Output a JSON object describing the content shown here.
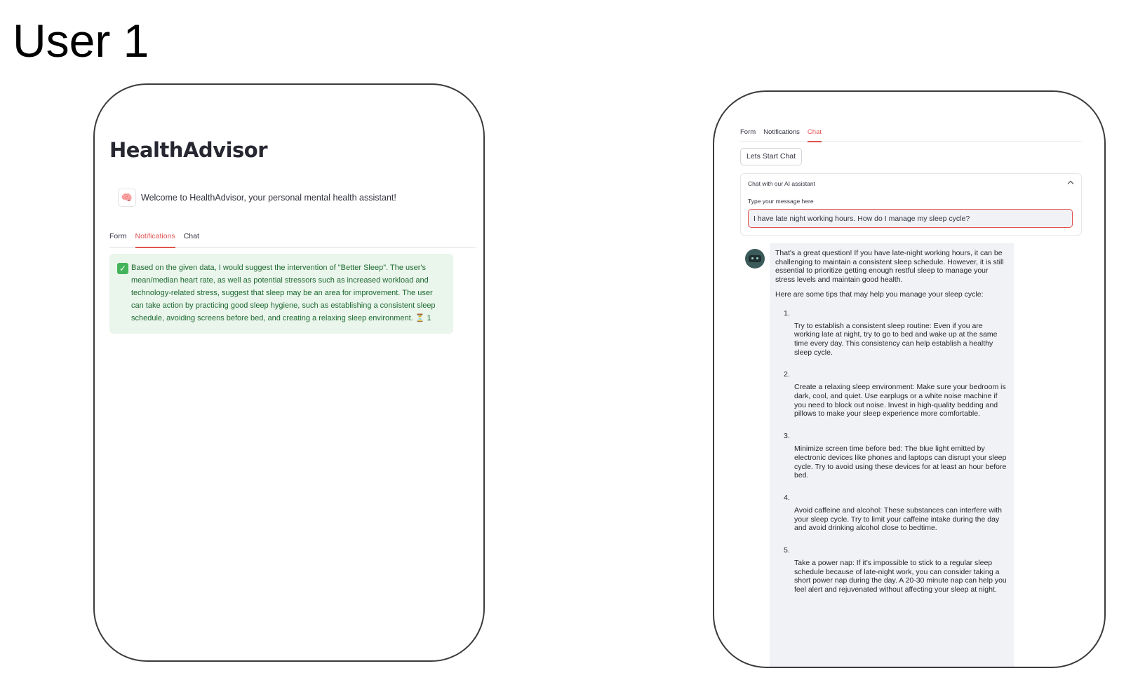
{
  "page": {
    "heading": "User 1"
  },
  "left_screen": {
    "app_title": "HealthAdvisor",
    "welcome_message": "Welcome to HealthAdvisor, your personal mental health assistant!",
    "avatar_emoji": "🧠",
    "tabs": [
      {
        "label": "Form",
        "active": false
      },
      {
        "label": "Notifications",
        "active": true
      },
      {
        "label": "Chat",
        "active": false
      }
    ],
    "notification": {
      "text": "Based on the given data, I would suggest the intervention of \"Better Sleep\". The user's mean/median heart rate, as well as potential stressors such as increased workload and technology-related stress, suggest that sleep may be an area for improvement. The user can take action by practicing good sleep hygiene, such as establishing a consistent sleep schedule, avoiding screens before bed, and creating a relaxing sleep environment. ⏳ 1",
      "icon": "check-icon"
    }
  },
  "right_screen": {
    "tabs": [
      {
        "label": "Form",
        "active": false
      },
      {
        "label": "Notifications",
        "active": false
      },
      {
        "label": "Chat",
        "active": true
      }
    ],
    "start_chat_button": "Lets Start Chat",
    "expander_title": "Chat with our AI assistant",
    "input_label": "Type your message here",
    "input_value": "I have late night working hours. How do I manage my sleep cycle?",
    "response": {
      "intro": "That's a great question! If you have late-night working hours, it can be challenging to maintain a consistent sleep schedule. However, it is still essential to prioritize getting enough restful sleep to manage your stress levels and maintain good health.",
      "lead": "Here are some tips that may help you manage your sleep cycle:",
      "tips": [
        {
          "number": "1.",
          "text": "Try to establish a consistent sleep routine: Even if you are working late at night, try to go to bed and wake up at the same time every day. This consistency can help establish a healthy sleep cycle."
        },
        {
          "number": "2.",
          "text": "Create a relaxing sleep environment: Make sure your bedroom is dark, cool, and quiet. Use earplugs or a white noise machine if you need to block out noise. Invest in high-quality bedding and pillows to make your sleep experience more comfortable."
        },
        {
          "number": "3.",
          "text": "Minimize screen time before bed: The blue light emitted by electronic devices like phones and laptops can disrupt your sleep cycle. Try to avoid using these devices for at least an hour before bed."
        },
        {
          "number": "4.",
          "text": "Avoid caffeine and alcohol: These substances can interfere with your sleep cycle. Try to limit your caffeine intake during the day and avoid drinking alcohol close to bedtime."
        },
        {
          "number": "5.",
          "text": "Take a power nap: If it's impossible to stick to a regular sleep schedule because of late-night work, you can consider taking a short power nap during the day. A 20-30 minute nap can help you feel alert and rejuvenated without affecting your sleep at night."
        }
      ]
    }
  }
}
